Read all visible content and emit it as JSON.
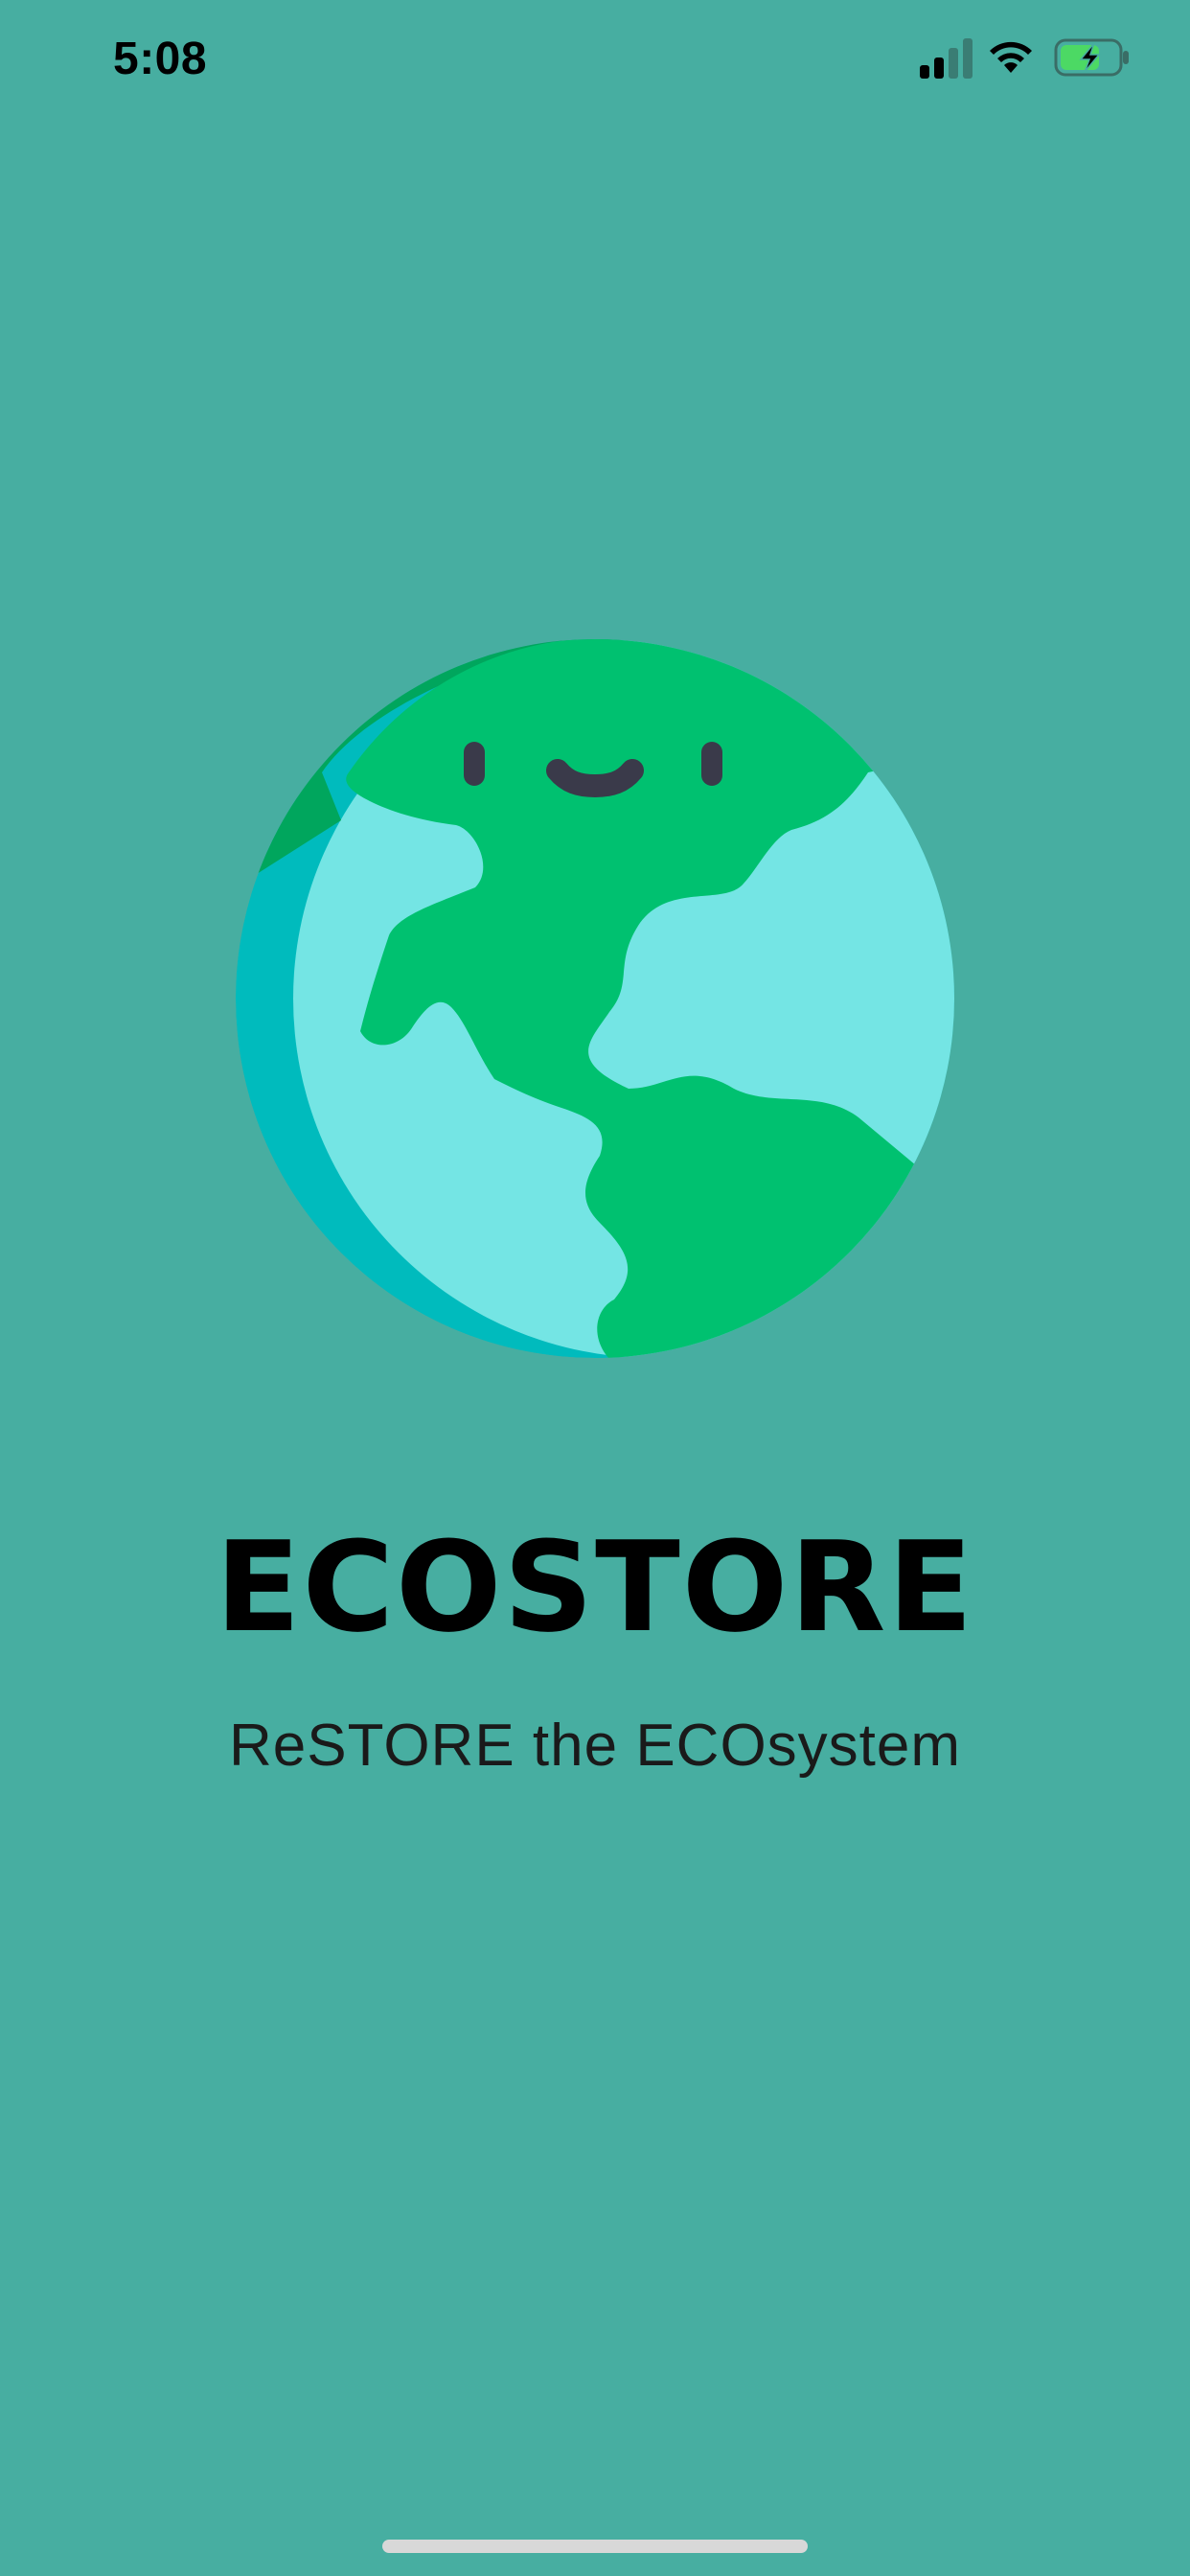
{
  "status_bar": {
    "time": "5:08",
    "icons": [
      "signal-icon",
      "wifi-icon",
      "battery-charging-icon"
    ]
  },
  "splash": {
    "logo": "earth-globe-smiling-icon",
    "title": "ECOSTORE",
    "tagline": "ReSTORE the ECOsystem"
  },
  "colors": {
    "background": "#47AEA1",
    "land": "#00C170",
    "land_shade": "#00A65D",
    "ocean": "#74E5E4",
    "ocean_shade": "#00BBBD",
    "face": "#3A3A4A",
    "battery_fill": "#4CD964"
  }
}
